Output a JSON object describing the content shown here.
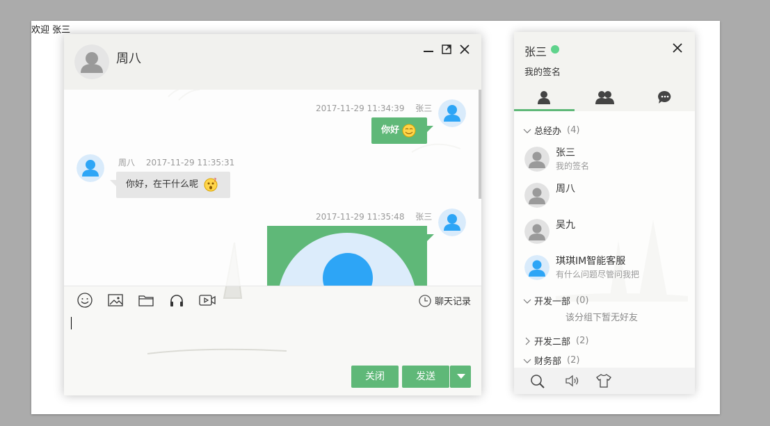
{
  "page": {
    "welcome": "欢迎 张三"
  },
  "chat": {
    "title": "周八",
    "messages": [
      {
        "sender": "张三",
        "time": "2017-11-29 11:34:39",
        "text": "你好",
        "mine": true,
        "emoji": "smile"
      },
      {
        "sender": "周八",
        "time": "2017-11-29 11:35:31",
        "text": "你好，在干什么呢",
        "mine": false,
        "emoji": "wonder"
      },
      {
        "sender": "张三",
        "time": "2017-11-29 11:35:48",
        "text": "",
        "mine": true,
        "image": "avatar-picture"
      }
    ],
    "toolbar": {
      "history_label": "聊天记录"
    },
    "buttons": {
      "close_label": "关闭",
      "send_label": "发送"
    }
  },
  "panel": {
    "user_name": "张三",
    "status": "online",
    "signature": "我的签名",
    "tabs": [
      "friends",
      "groups",
      "history"
    ],
    "groups": [
      {
        "name": "总经办",
        "count": "(4)",
        "expanded": true,
        "friends": [
          {
            "name": "张三",
            "sign": "我的签名",
            "avatar": "gray"
          },
          {
            "name": "周八",
            "sign": "",
            "avatar": "gray"
          },
          {
            "name": "吴九",
            "sign": "",
            "avatar": "gray"
          },
          {
            "name": "琪琪IM智能客服",
            "sign": "有什么问题尽管问我把",
            "avatar": "blue"
          }
        ]
      },
      {
        "name": "开发一部",
        "count": "(0)",
        "expanded": true,
        "empty_text": "该分组下暂无好友"
      },
      {
        "name": "开发二部",
        "count": "(2)",
        "expanded": false
      },
      {
        "name": "财务部",
        "count": "(2)",
        "expanded": true
      }
    ]
  },
  "colors": {
    "accent": "#5fb878",
    "online": "#5fd38c",
    "avatar_blue": "#2da5f6",
    "avatar_gray": "#999999"
  }
}
